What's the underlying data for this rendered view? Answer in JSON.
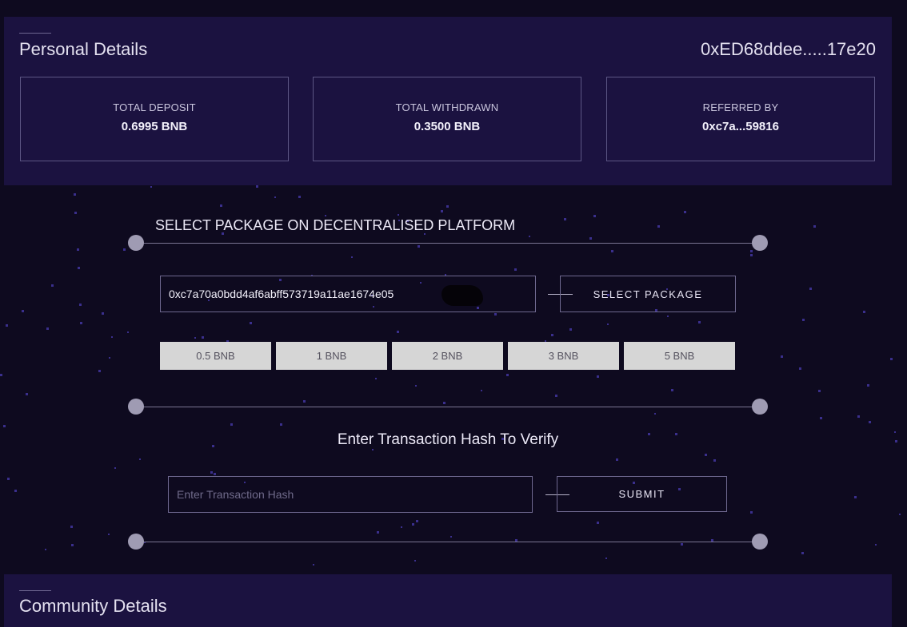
{
  "personal": {
    "title": "Personal Details",
    "wallet": "0xED68ddee.....17e20",
    "stats": [
      {
        "label": "TOTAL DEPOSIT",
        "value": "0.6995 BNB"
      },
      {
        "label": "TOTAL WITHDRAWN",
        "value": "0.3500 BNB"
      },
      {
        "label": "REFERRED BY",
        "value": "0xc7a...59816"
      }
    ]
  },
  "package": {
    "title": "SELECT PACKAGE ON DECENTRALISED PLATFORM",
    "referrer_value": "0xc7a70a0bdd4af6abff573719a11ae1674e05",
    "select_label": "SELECT PACKAGE",
    "options": [
      "0.5 BNB",
      "1 BNB",
      "2 BNB",
      "3 BNB",
      "5 BNB"
    ]
  },
  "verify": {
    "title": "Enter Transaction Hash To Verify",
    "placeholder": "Enter Transaction Hash",
    "submit_label": "SUBMIT"
  },
  "community": {
    "title": "Community Details"
  },
  "colors": {
    "background": "#0e0a1f",
    "panel": "#1b1240",
    "package_button": "#d6d6d6",
    "accent_star": "#3a2f8c"
  }
}
